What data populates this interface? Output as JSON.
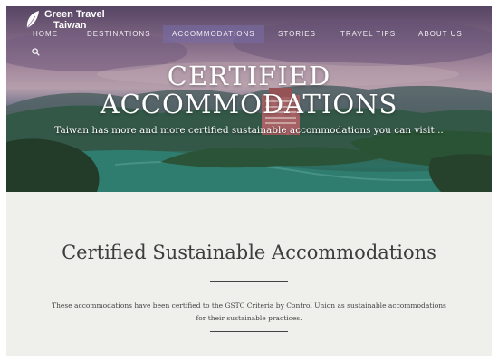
{
  "brand": {
    "line1": "Green Travel",
    "line2": "Taiwan"
  },
  "nav": {
    "items": [
      {
        "label": "HOME"
      },
      {
        "label": "DESTINATIONS"
      },
      {
        "label": "ACCOMMODATIONS",
        "active": true
      },
      {
        "label": "STORIES"
      },
      {
        "label": "TRAVEL TIPS"
      },
      {
        "label": "ABOUT US"
      }
    ],
    "search_icon": "search-icon"
  },
  "hero": {
    "title_line1": "CERTIFIED",
    "title_line2": "ACCOMMODATIONS",
    "subtitle": "Taiwan has more and more certified sustainable accommodations you can visit..."
  },
  "content": {
    "title": "Certified Sustainable Accommodations",
    "description_line1": "These accommodations have been certified to the GSTC Criteria by Control Union as sustainable accommodations",
    "description_line2": "for their sustainable practices."
  },
  "colors": {
    "nav_active_bg": "#786eaa",
    "content_bg": "#efefeb",
    "text_dark": "#3d3d3d"
  }
}
